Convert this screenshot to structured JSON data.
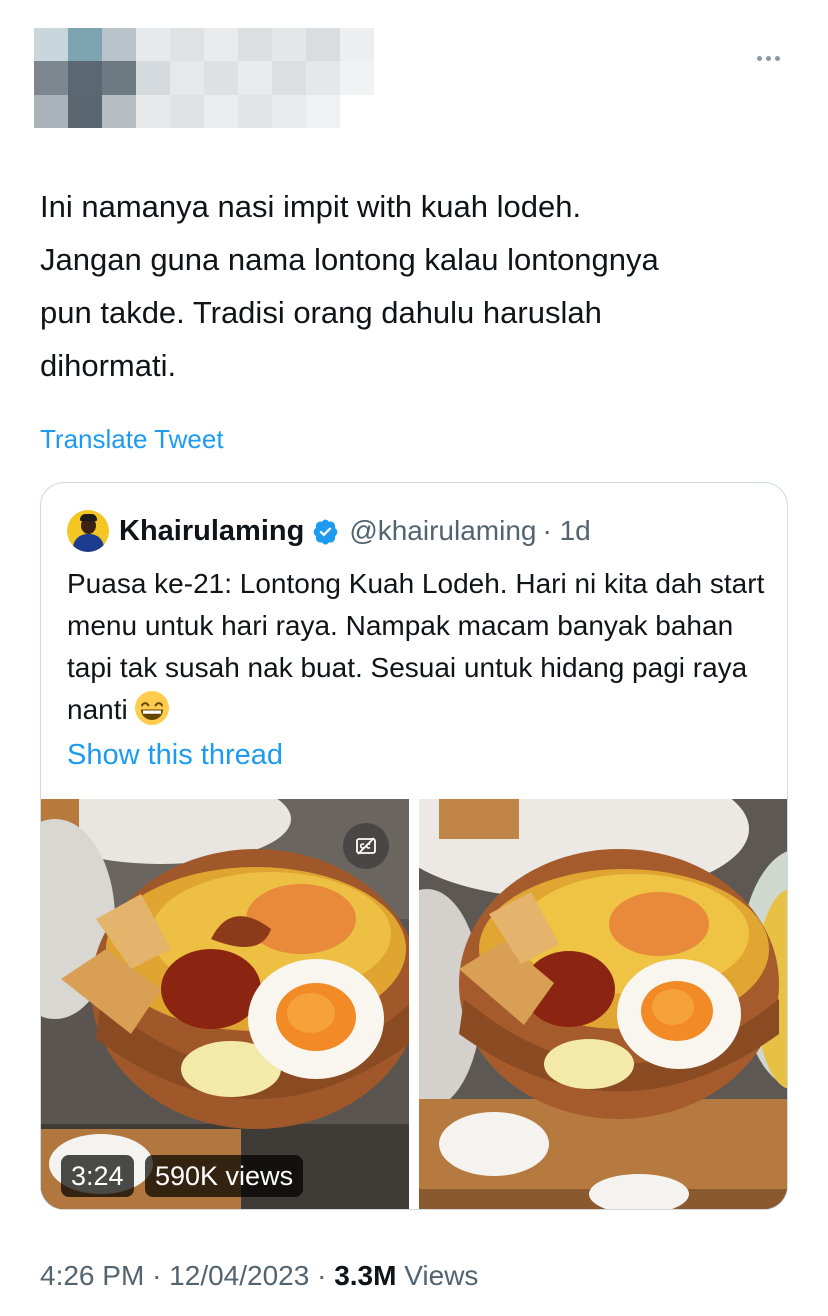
{
  "tweet": {
    "text": "Ini namanya nasi impit with kuah lodeh.\nJangan guna nama lontong kalau lontongnya\npun takde. Tradisi orang dahulu haruslah\ndihormati.",
    "translate_label": "Translate Tweet",
    "more_icon": "more-horizontal-icon"
  },
  "quoted": {
    "display_name": "Khairulaming",
    "handle": "@khairulaming",
    "time": "· 1d",
    "text": "Puasa ke-21: Lontong Kuah Lodeh. Hari ni kita dah start menu untuk hari raya. Nampak macam banyak bahan tapi tak susah nak buat. Sesuai untuk hidang pagi raya nanti",
    "emoji_icon": "grinning-face-icon",
    "show_thread_label": "Show this thread",
    "video": {
      "duration": "3:24",
      "views": "590K views"
    }
  },
  "meta": {
    "time": "4:26 PM",
    "date": "12/04/2023",
    "separator": "·",
    "views_count": "3.3M",
    "views_label": "Views"
  },
  "colors": {
    "link": "#1d9bf0",
    "text": "#0f1419",
    "secondary": "#536471",
    "border": "#cfd9de",
    "verified": "#1d9bf0"
  }
}
